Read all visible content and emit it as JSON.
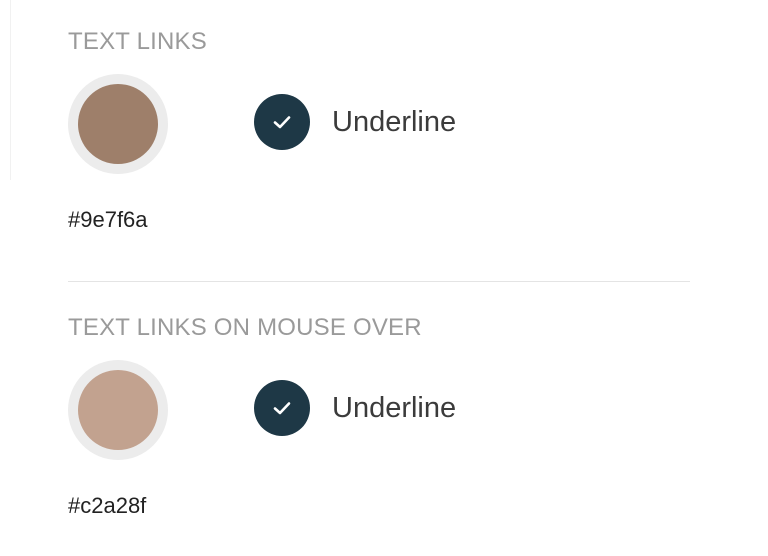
{
  "sections": [
    {
      "title": "TEXT LINKS",
      "color": "#9e7f6a",
      "hex_label": "#9e7f6a",
      "underline_label": "Underline",
      "underline_checked": true
    },
    {
      "title": "TEXT LINKS ON MOUSE OVER",
      "color": "#c2a28f",
      "hex_label": "#c2a28f",
      "underline_label": "Underline",
      "underline_checked": true
    }
  ],
  "colors": {
    "checkbox_fill": "#1e3846",
    "swatch_ring": "#ececec",
    "title_text": "#9a9a9a"
  },
  "icons": {
    "checkbox": "checkmark-icon"
  }
}
